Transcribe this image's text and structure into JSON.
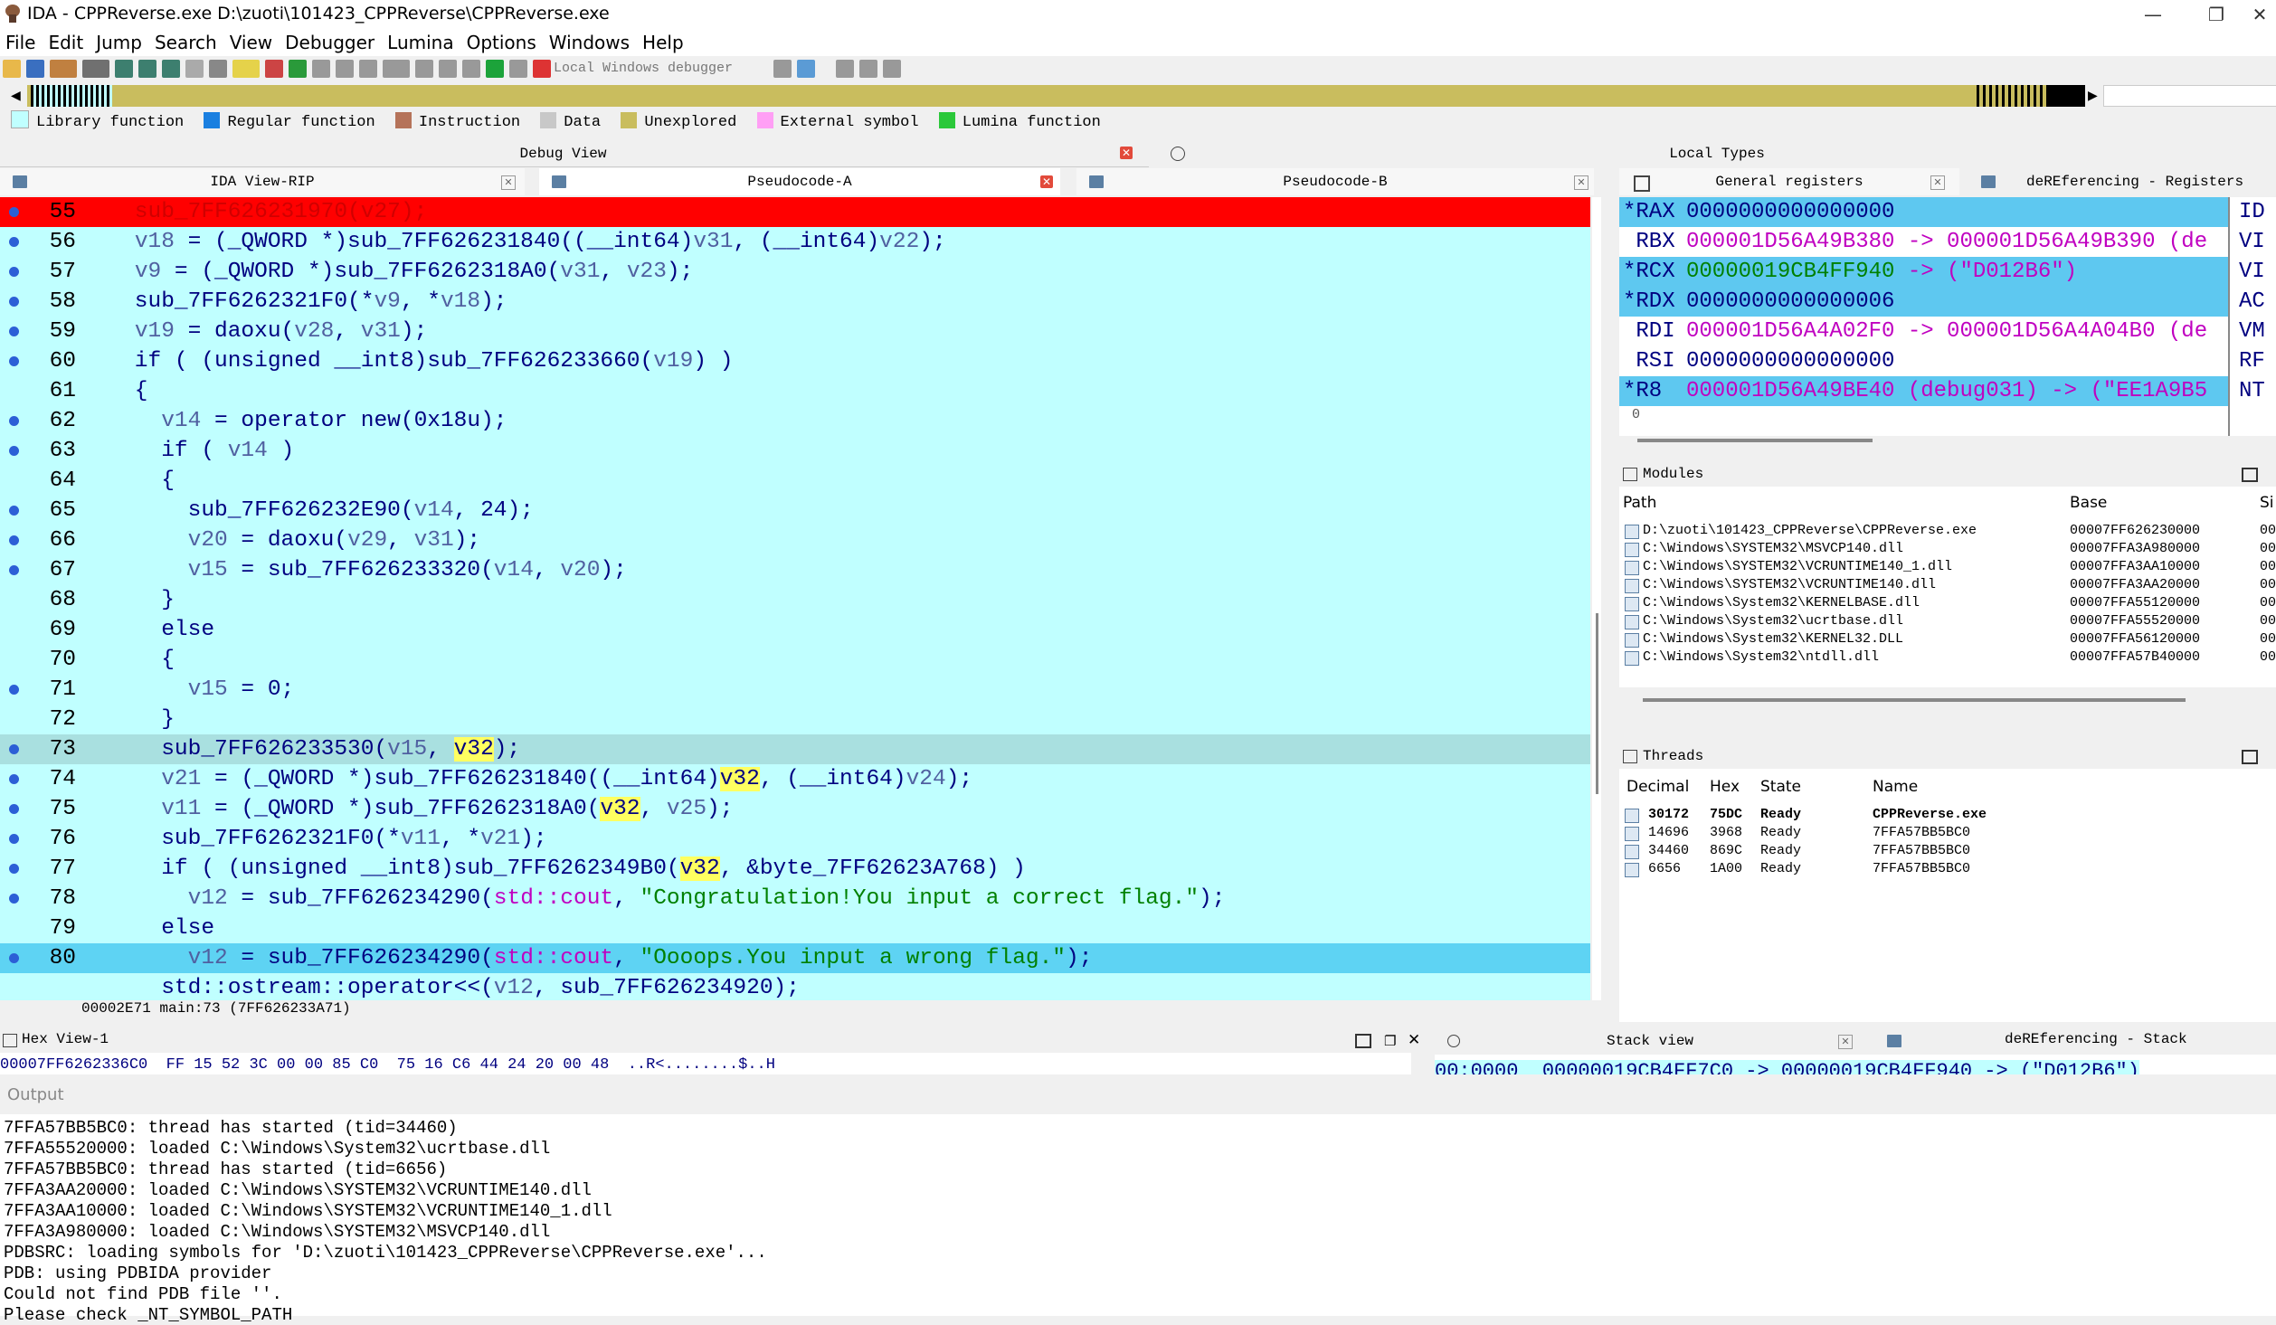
{
  "window": {
    "title": "IDA - CPPReverse.exe D:\\zuoti\\101423_CPPReverse\\CPPReverse.exe",
    "minimize": "—",
    "restore": "❐",
    "close": "✕"
  },
  "menu": [
    "File",
    "Edit",
    "Jump",
    "Search",
    "View",
    "Debugger",
    "Lumina",
    "Options",
    "Windows",
    "Help"
  ],
  "toolbar": {
    "debugger": "Local Windows debugger"
  },
  "legend": [
    {
      "label": "Library function",
      "color": "#c0ffff"
    },
    {
      "label": "Regular function",
      "color": "#1a7fe0"
    },
    {
      "label": "Instruction",
      "color": "#b5735a"
    },
    {
      "label": "Data",
      "color": "#c8c8c8"
    },
    {
      "label": "Unexplored",
      "color": "#c9bd5e"
    },
    {
      "label": "External symbol",
      "color": "#ff9ff5"
    },
    {
      "label": "Lumina function",
      "color": "#2bc83a"
    }
  ],
  "panes": {
    "debug_view": "Debug View",
    "local_types": "Local Types",
    "ida_view": "IDA View-RIP",
    "pseudo_a": "Pseudocode-A",
    "pseudo_b": "Pseudocode-B",
    "gen_regs": "General registers",
    "deref_regs": "deREferencing - Registers",
    "modules": "Modules",
    "threads": "Threads",
    "hex_view": "Hex View-1",
    "stack_view": "Stack view",
    "deref_stack": "deREferencing - Stack",
    "output": "Output"
  },
  "code": [
    {
      "ln": "55",
      "dot": true,
      "text": "    sub_7FF626231970(v27);",
      "style": "bp"
    },
    {
      "ln": "56",
      "dot": true,
      "text": "    v18 = (_QWORD *)sub_7FF626231840((__int64)v31, (__int64)v22);"
    },
    {
      "ln": "57",
      "dot": true,
      "text": "    v9 = (_QWORD *)sub_7FF6262318A0(v31, v23);"
    },
    {
      "ln": "58",
      "dot": true,
      "text": "    sub_7FF6262321F0(*v9, *v18);"
    },
    {
      "ln": "59",
      "dot": true,
      "text": "    v19 = daoxu(v28, v31);"
    },
    {
      "ln": "60",
      "dot": true,
      "text": "    if ( (unsigned __int8)sub_7FF626233660(v19) )"
    },
    {
      "ln": "61",
      "dot": false,
      "text": "    {"
    },
    {
      "ln": "62",
      "dot": true,
      "text": "      v14 = operator new(0x18u);"
    },
    {
      "ln": "63",
      "dot": true,
      "text": "      if ( v14 )"
    },
    {
      "ln": "64",
      "dot": false,
      "text": "      {"
    },
    {
      "ln": "65",
      "dot": true,
      "text": "        sub_7FF626232E90(v14, 24);"
    },
    {
      "ln": "66",
      "dot": true,
      "text": "        v20 = daoxu(v29, v31);"
    },
    {
      "ln": "67",
      "dot": true,
      "text": "        v15 = sub_7FF626233320(v14, v20);"
    },
    {
      "ln": "68",
      "dot": false,
      "text": "      }"
    },
    {
      "ln": "69",
      "dot": false,
      "text": "      else"
    },
    {
      "ln": "70",
      "dot": false,
      "text": "      {"
    },
    {
      "ln": "71",
      "dot": true,
      "text": "        v15 = 0;"
    },
    {
      "ln": "72",
      "dot": false,
      "text": "      }"
    },
    {
      "ln": "73",
      "dot": true,
      "text": "      sub_7FF626233530(v15, v32);",
      "style": "cur"
    },
    {
      "ln": "74",
      "dot": true,
      "text": "      v21 = (_QWORD *)sub_7FF626231840((__int64)v32, (__int64)v24);"
    },
    {
      "ln": "75",
      "dot": true,
      "text": "      v11 = (_QWORD *)sub_7FF6262318A0(v32, v25);"
    },
    {
      "ln": "76",
      "dot": true,
      "text": "      sub_7FF6262321F0(*v11, *v21);"
    },
    {
      "ln": "77",
      "dot": true,
      "text": "      if ( (unsigned __int8)sub_7FF6262349B0(v32, &byte_7FF62623A768) )"
    },
    {
      "ln": "78",
      "dot": true,
      "text": "        v12 = sub_7FF626234290(std::cout, \"Congratulation!You input a correct flag.\");"
    },
    {
      "ln": "79",
      "dot": false,
      "text": "      else"
    },
    {
      "ln": "80",
      "dot": true,
      "text": "        v12 = sub_7FF626234290(std::cout, \"Oooops.You input a wrong flag.\");",
      "style": "ip"
    },
    {
      "ln": "",
      "dot": false,
      "text": "      std::ostream::operator<<(v12, sub_7FF626234920);"
    }
  ],
  "code_status": "00002E71 main:73 (7FF626233A71)",
  "registers": [
    {
      "name": "*RAX",
      "value": "0000000000000000",
      "rest": "",
      "hl": true
    },
    {
      "name": " RBX",
      "value": "000001D56A49B380",
      "rest": " -> 000001D56A49B390 (de",
      "hl": false
    },
    {
      "name": "*RCX",
      "value": "00000019CB4FF940",
      "rest": " -> (\"D012B6\")",
      "hl": true
    },
    {
      "name": "*RDX",
      "value": "0000000000000006",
      "rest": "",
      "hl": true
    },
    {
      "name": " RDI",
      "value": "000001D56A4A02F0",
      "rest": " -> 000001D56A4A04B0 (de",
      "hl": false
    },
    {
      "name": " RSI",
      "value": "0000000000000000",
      "rest": "",
      "hl": false
    },
    {
      "name": "*R8",
      "value": "000001D56A49BE40",
      "rest": " (debug031) -> (\"EE1A9B5",
      "hl": true
    }
  ],
  "reg_side": [
    "ID",
    "VI",
    "VI",
    "AC",
    "VM",
    "RF",
    "NT"
  ],
  "reg_footer": "0",
  "modules": {
    "headers": [
      "Path",
      "Base",
      "Si"
    ],
    "rows": [
      [
        "D:\\zuoti\\101423_CPPReverse\\CPPReverse.exe",
        "00007FF626230000",
        "00"
      ],
      [
        "C:\\Windows\\SYSTEM32\\MSVCP140.dll",
        "00007FFA3A980000",
        "00"
      ],
      [
        "C:\\Windows\\SYSTEM32\\VCRUNTIME140_1.dll",
        "00007FFA3AA10000",
        "00"
      ],
      [
        "C:\\Windows\\SYSTEM32\\VCRUNTIME140.dll",
        "00007FFA3AA20000",
        "00"
      ],
      [
        "C:\\Windows\\System32\\KERNELBASE.dll",
        "00007FFA55120000",
        "00"
      ],
      [
        "C:\\Windows\\System32\\ucrtbase.dll",
        "00007FFA55520000",
        "00"
      ],
      [
        "C:\\Windows\\System32\\KERNEL32.DLL",
        "00007FFA56120000",
        "00"
      ],
      [
        "C:\\Windows\\System32\\ntdll.dll",
        "00007FFA57B40000",
        "00"
      ]
    ]
  },
  "threads": {
    "headers": [
      "Decimal",
      "Hex",
      "State",
      "Name"
    ],
    "rows": [
      [
        "30172",
        "75DC",
        "Ready",
        "CPPReverse.exe"
      ],
      [
        "14696",
        "3968",
        "Ready",
        "7FFA57BB5BC0"
      ],
      [
        "34460",
        "869C",
        "Ready",
        "7FFA57BB5BC0"
      ],
      [
        "6656",
        "1A00",
        "Ready",
        "7FFA57BB5BC0"
      ]
    ]
  },
  "hex_line": "00007FF6262336C0  FF 15 52 3C 00 00 85 C0  75 16 C6 44 24 20 00 48  ..R<........$..H",
  "stack_line": "00:0000  00000019CB4FF7C0 -> 00000019CB4FF940 -> (\"D012B6\")",
  "output_lines": [
    "7FFA57BB5BC0: thread has started (tid=34460)",
    "7FFA55520000: loaded C:\\Windows\\System32\\ucrtbase.dll",
    "7FFA57BB5BC0: thread has started (tid=6656)",
    "7FFA3AA20000: loaded C:\\Windows\\SYSTEM32\\VCRUNTIME140.dll",
    "7FFA3AA10000: loaded C:\\Windows\\SYSTEM32\\VCRUNTIME140_1.dll",
    "7FFA3A980000: loaded C:\\Windows\\SYSTEM32\\MSVCP140.dll",
    "PDBSRC: loading symbols for 'D:\\zuoti\\101423_CPPReverse\\CPPReverse.exe'...",
    "PDB: using PDBIDA provider",
    "Could not find PDB file ''.",
    "Please check _NT_SYMBOL_PATH"
  ],
  "colors": {
    "bp": "#ff0000",
    "current": "#a9e0e0",
    "ip": "#5ed3f3",
    "code_bg": "#c0ffff",
    "var_hl": "#ffff60"
  }
}
